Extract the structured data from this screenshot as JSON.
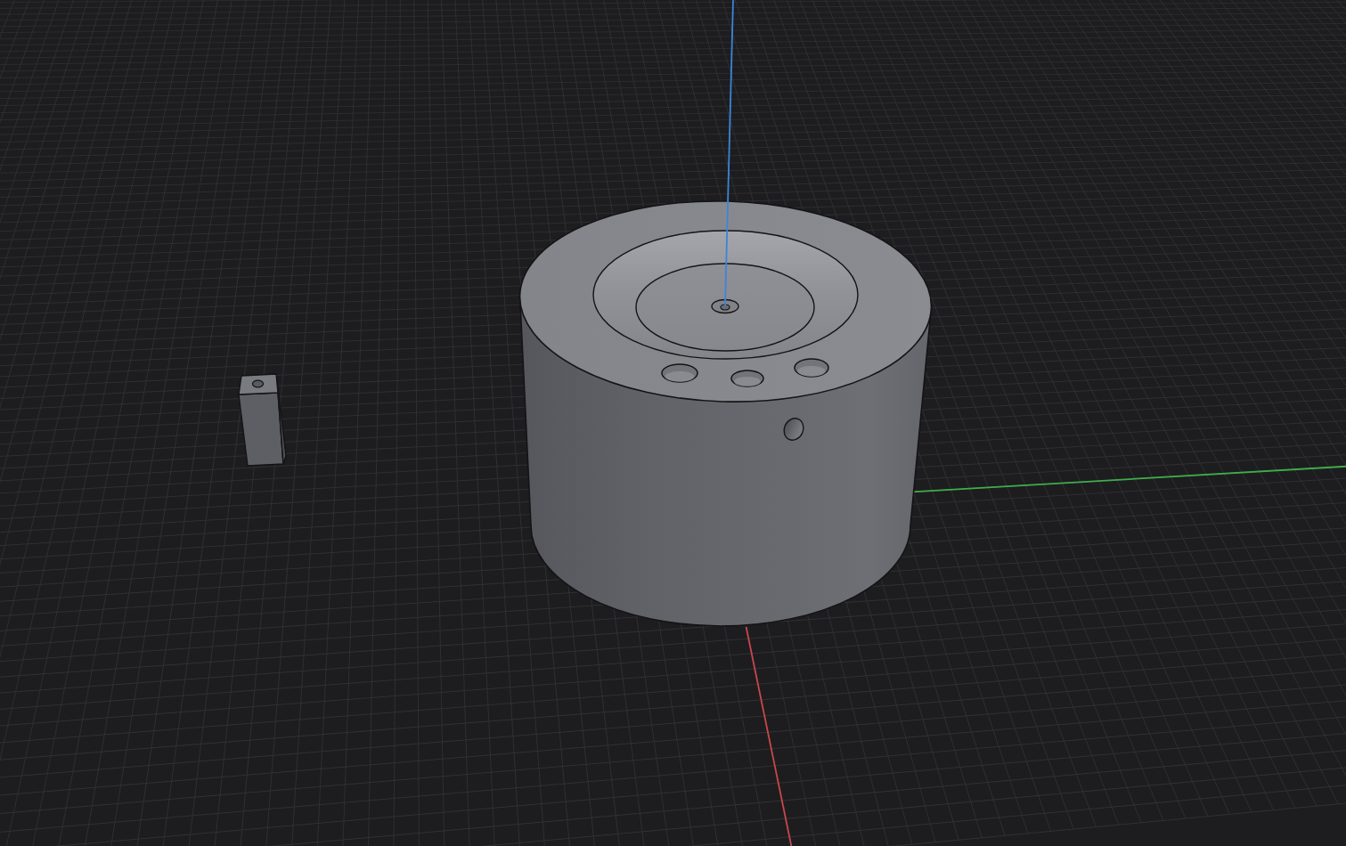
{
  "viewport": {
    "axes": [
      {
        "kind": "x",
        "color": "#c8474b"
      },
      {
        "kind": "y",
        "color": "#3fae4a"
      },
      {
        "kind": "z",
        "color": "#3d84d9"
      }
    ],
    "objects": [
      {
        "kind": "cylinder"
      },
      {
        "kind": "block"
      }
    ]
  }
}
